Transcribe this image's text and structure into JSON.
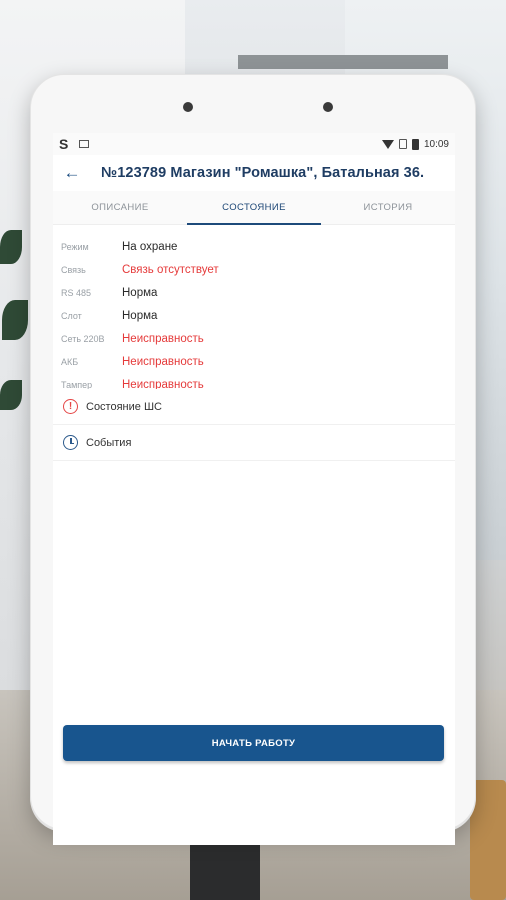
{
  "statusbar": {
    "time": "10:09"
  },
  "appbar": {
    "title": "№123789 Магазин \"Ромашка\", Батальная 36."
  },
  "tabs": [
    {
      "label": "ОПИСАНИЕ"
    },
    {
      "label": "СОСТОЯНИЕ"
    },
    {
      "label": "ИСТОРИЯ"
    }
  ],
  "status_rows": [
    {
      "key": "Режим",
      "value": "На охране"
    },
    {
      "key": "Связь",
      "value": "Связь отсутствует"
    },
    {
      "key": "RS 485",
      "value": "Норма"
    },
    {
      "key": "Слот",
      "value": "Норма"
    },
    {
      "key": "Сеть 220В",
      "value": "Неисправность"
    },
    {
      "key": "АКБ",
      "value": "Неисправность"
    },
    {
      "key": "Тампер",
      "value": "Неисправность"
    }
  ],
  "sections": [
    {
      "label": "Состояние ШС"
    },
    {
      "label": "События"
    }
  ],
  "primary_button": {
    "label": "НАЧАТЬ РАБОТУ"
  },
  "colors": {
    "accent": "#18558e",
    "error": "#e53a3a",
    "title": "#1f3d63"
  }
}
